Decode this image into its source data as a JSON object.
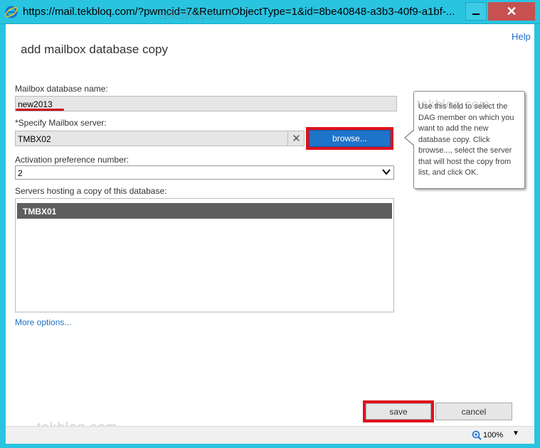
{
  "window": {
    "url": "https://mail.tekbloq.com/?pwmcid=7&ReturnObjectType=1&id=8be40848-a3b3-40f9-a1bf-...",
    "close_glyph": "✕"
  },
  "header": {
    "help_label": "Help",
    "page_title": "add mailbox database copy"
  },
  "form": {
    "db_name_label": "Mailbox database name:",
    "db_name_value": "new2013",
    "server_label": "*Specify Mailbox server:",
    "server_value": "TMBX02",
    "clear_glyph": "✕",
    "browse_label": "browse...",
    "activation_label": "Activation preference number:",
    "activation_value": "2",
    "servers_label": "Servers hosting a copy of this database:",
    "servers": [
      "TMBX01"
    ],
    "more_options_label": "More options..."
  },
  "callout": {
    "text": "Use this field to select the DAG member on which you want to add the new database copy. Click browse..., select the server that will host the copy from list, and click OK."
  },
  "footer": {
    "save_label": "save",
    "cancel_label": "cancel"
  },
  "status": {
    "zoom": "100%",
    "zoom_dropdown_glyph": "▼"
  },
  "watermarks": {
    "top": "tekbloq.com",
    "callout": "tekbloq.com",
    "bottom": "tekbloq.com"
  },
  "colors": {
    "titlebar": "#29c4e0",
    "highlight": "#e0111c",
    "browse_button": "#1e74c9",
    "selected_row": "#5e5e5e",
    "link": "#1e6fc4"
  }
}
